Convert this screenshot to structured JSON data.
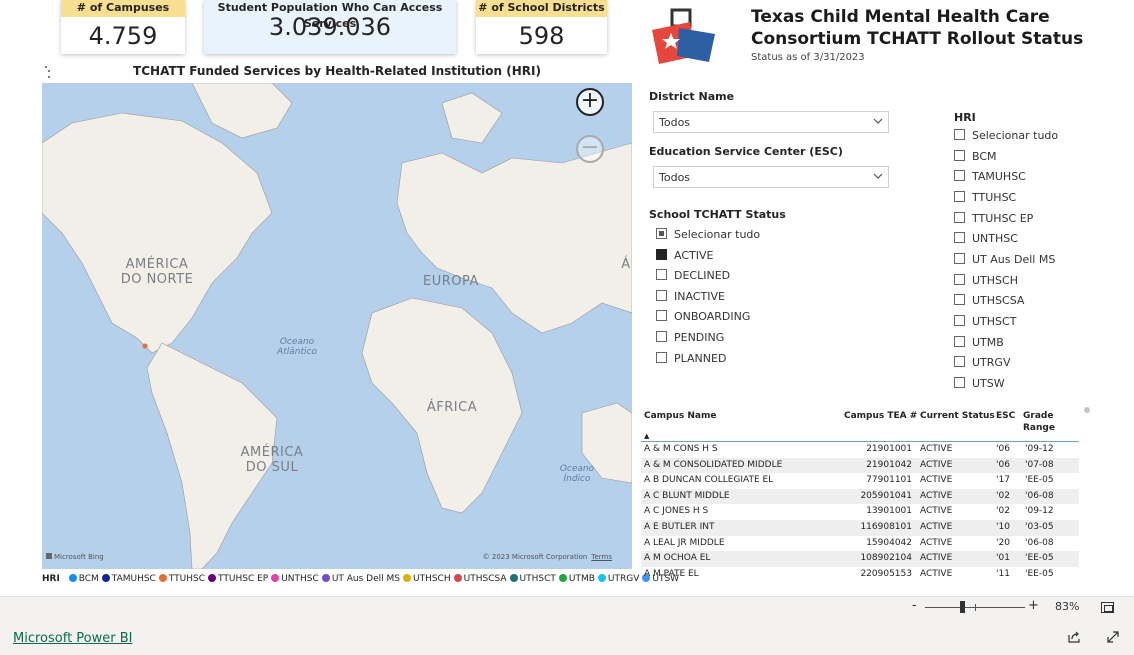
{
  "kpis": {
    "campuses": {
      "label": "# of Campuses",
      "value": "4.759"
    },
    "population": {
      "label": "Student Population Who Can Access Services",
      "value": "3.039.036"
    },
    "districts": {
      "label": "# of School Districts",
      "value": "598"
    }
  },
  "report": {
    "title_line1": "Texas Child Mental Health Care",
    "title_line2": "Consortium TCHATT Rollout Status",
    "status_date": "Status as of 3/31/2023"
  },
  "map": {
    "title": "TCHATT Funded Services by Health-Related Institution (HRI)",
    "labels": {
      "north_america": "AMÉRICA\nDO NORTE",
      "europe": "EUROPA",
      "africa": "ÁFRICA",
      "south_america": "AMÉRICA\nDO SUL",
      "asia_partial": "Á",
      "atlantic": "Oceano\nAtlântico",
      "indian": "Oceano\nÍndico"
    },
    "attribution": "Microsoft Bing",
    "copyright": "© 2023 Microsoft Corporation",
    "terms": "Terms",
    "zoom_in": "+",
    "zoom_out": "−",
    "colors": {
      "ocean": "#b5d0ea",
      "land": "#f2efe9",
      "border": "#8a8a8a"
    }
  },
  "legend": {
    "title": "HRI",
    "items": [
      {
        "label": "BCM",
        "color": "#118dff"
      },
      {
        "label": "TAMUHSC",
        "color": "#12239e"
      },
      {
        "label": "TTUHSC",
        "color": "#e66c37"
      },
      {
        "label": "TTUHSC EP",
        "color": "#6b007b"
      },
      {
        "label": "UNTHSC",
        "color": "#e044a7"
      },
      {
        "label": "UT Aus Dell MS",
        "color": "#744ec2"
      },
      {
        "label": "UTHSCH",
        "color": "#d9b300"
      },
      {
        "label": "UTHSCSA",
        "color": "#d64550"
      },
      {
        "label": "UTHSCT",
        "color": "#197278"
      },
      {
        "label": "UTMB",
        "color": "#1aab40"
      },
      {
        "label": "UTRGV",
        "color": "#15c6f4"
      },
      {
        "label": "UTSW",
        "color": "#4092ff"
      }
    ]
  },
  "filters": {
    "district": {
      "title": "District Name",
      "value": "Todos"
    },
    "esc": {
      "title": "Education Service Center (ESC)",
      "value": "Todos"
    },
    "status": {
      "title": "School TCHATT Status",
      "items": [
        {
          "label": "Selecionar tudo",
          "state": "partial"
        },
        {
          "label": "ACTIVE",
          "state": "checked"
        },
        {
          "label": "DECLINED",
          "state": "unchecked"
        },
        {
          "label": "INACTIVE",
          "state": "unchecked"
        },
        {
          "label": "ONBOARDING",
          "state": "unchecked"
        },
        {
          "label": "PENDING",
          "state": "unchecked"
        },
        {
          "label": "PLANNED",
          "state": "unchecked"
        }
      ]
    },
    "hri": {
      "title": "HRI",
      "items": [
        {
          "label": "Selecionar tudo"
        },
        {
          "label": "BCM"
        },
        {
          "label": "TAMUHSC"
        },
        {
          "label": "TTUHSC"
        },
        {
          "label": "TTUHSC EP"
        },
        {
          "label": "UNTHSC"
        },
        {
          "label": "UT Aus Dell MS"
        },
        {
          "label": "UTHSCH"
        },
        {
          "label": "UTHSCSA"
        },
        {
          "label": "UTHSCT"
        },
        {
          "label": "UTMB"
        },
        {
          "label": "UTRGV"
        },
        {
          "label": "UTSW"
        }
      ]
    }
  },
  "table": {
    "columns": [
      "Campus Name",
      "Campus TEA #",
      "Current Status",
      "ESC",
      "Grade Range"
    ],
    "sort_indicator": "▲",
    "rows": [
      [
        "A & M CONS H S",
        "21901001",
        "ACTIVE",
        "'06",
        "'09-12"
      ],
      [
        "A & M CONSOLIDATED MIDDLE",
        "21901042",
        "ACTIVE",
        "'06",
        "'07-08"
      ],
      [
        "A B DUNCAN COLLEGIATE EL",
        "77901101",
        "ACTIVE",
        "'17",
        "'EE-05"
      ],
      [
        "A C BLUNT MIDDLE",
        "205901041",
        "ACTIVE",
        "'02",
        "'06-08"
      ],
      [
        "A C JONES H S",
        "13901001",
        "ACTIVE",
        "'02",
        "'09-12"
      ],
      [
        "A E BUTLER INT",
        "116908101",
        "ACTIVE",
        "'10",
        "'03-05"
      ],
      [
        "A LEAL JR MIDDLE",
        "15904042",
        "ACTIVE",
        "'20",
        "'06-08"
      ],
      [
        "A M OCHOA EL",
        "108902104",
        "ACTIVE",
        "'01",
        "'EE-05"
      ],
      [
        "A M PATE EL",
        "220905153",
        "ACTIVE",
        "'11",
        "'EE-05"
      ]
    ]
  },
  "statusbar": {
    "zoom_minus": "-",
    "zoom_plus": "+",
    "zoom_percent": "83%"
  },
  "footer": {
    "brand_link": "Microsoft Power BI"
  }
}
